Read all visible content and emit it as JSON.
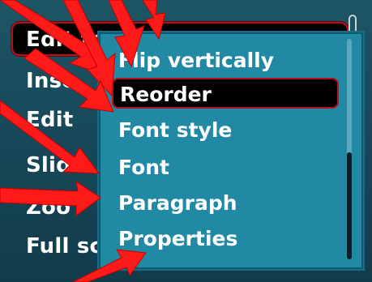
{
  "main_menu": {
    "items": [
      {
        "label": "Edit te"
      },
      {
        "label": "Inse"
      },
      {
        "label": "Edit"
      },
      {
        "label": "Slid"
      },
      {
        "label": "Zoo"
      },
      {
        "label": "Full sc"
      }
    ]
  },
  "submenu": {
    "items": [
      {
        "label": "Flip vertically"
      },
      {
        "label": "Reorder"
      },
      {
        "label": "Font style"
      },
      {
        "label": "Font"
      },
      {
        "label": "Paragraph"
      },
      {
        "label": "Properties"
      }
    ]
  },
  "colors": {
    "background": "#17495a",
    "submenu_background": "#2289a5",
    "highlight": "#000000",
    "highlight_border": "#b80f18",
    "annotation_arrow": "#ff1a1a"
  }
}
